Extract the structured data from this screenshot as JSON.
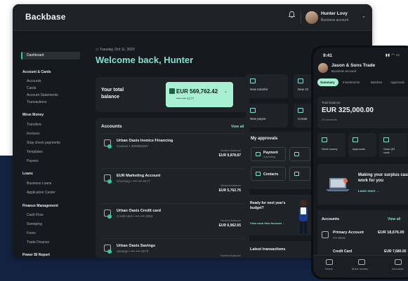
{
  "desktop": {
    "brand": "Backbase",
    "user": {
      "name": "Hunter Lovy",
      "subtitle": "Business account"
    },
    "sidebar": {
      "active": "Dashboard",
      "groups": [
        {
          "title": "Account & Cards",
          "items": [
            "Accounts",
            "Cards",
            "Account Statements",
            "Transactions"
          ]
        },
        {
          "title": "Move Money",
          "items": [
            "Transfers",
            "Invoices",
            "Stop check payments",
            "Templates",
            "Payees"
          ]
        },
        {
          "title": "Loans",
          "items": [
            "Business Loans",
            "Application Center"
          ]
        },
        {
          "title": "Finance Management",
          "items": [
            "Cash Flow",
            "Sweeping",
            "Forex",
            "Trade Finance"
          ]
        },
        {
          "title": "Power BI Report",
          "items": []
        }
      ]
    },
    "date": "Tuesday, Oct 11, 2023",
    "welcome": "Welcome back, Hunter",
    "total_balance": {
      "label": "Your total balance",
      "amount": "EUR 569,762.42",
      "account": "•••• •••• 5177"
    },
    "accounts": {
      "title": "Accounts",
      "view_all": "View all",
      "rows": [
        {
          "name": "Urban Oasis Invoice Financing",
          "sub": "Invoices • 3026084927",
          "balance_label": "Booked balance",
          "balance": "EUR 9,878.87"
        },
        {
          "name": "EUR Marketing Account",
          "sub": "Checking • •••• •••• 5177",
          "balance_label": "Booked balance",
          "balance": "EUR 5,762.76"
        },
        {
          "name": "Urban Oasis Credit card",
          "sub": "Credit card • •••• •••• 2083",
          "balance_label": "Booked balance",
          "balance": "EUR 6,962.65"
        },
        {
          "name": "Urban Oasis Savings",
          "sub": "Savings • •••• •••• 8273",
          "balance_label": "Booked balance",
          "balance": ""
        }
      ]
    },
    "quick_actions": [
      "New transfer",
      "New ch",
      "New payee",
      "Create"
    ],
    "approvals": {
      "title": "My approvals",
      "items": [
        {
          "label": "Payment",
          "sub": "3 pending"
        },
        {
          "label": "Contacts",
          "sub": ""
        }
      ]
    },
    "budget": {
      "title": "Ready for next year's budget?",
      "link": "View cash flow forecast →"
    },
    "latest": "Latest transactions"
  },
  "phone": {
    "time": "9:41",
    "company": "Jason & Sons Trade",
    "subtitle": "Business account",
    "tabs": [
      "Summary",
      "Investments",
      "Batches",
      "Approvals"
    ],
    "active_tab": "Summary",
    "balance": {
      "label": "Total balance",
      "amount": "EUR 325,000.00",
      "sub": "24 accounts"
    },
    "quick_actions": [
      "Send money",
      "Approvals",
      "Scan QR code"
    ],
    "promo": {
      "title": "Making your surplus cash work for you",
      "link": "Learn more →"
    },
    "accounts": {
      "title": "Accounts",
      "view_all": "View all",
      "rows": [
        {
          "name": "Primary Account",
          "sub": "•••• 5823",
          "amount": "EUR 18,676.00"
        },
        {
          "name": "Credit Card",
          "amount": "EUR 7,680.00"
        }
      ]
    },
    "nav": [
      "Home",
      "Move money",
      "Accounts"
    ]
  },
  "colors": {
    "accent": "#7fe3d1",
    "pill": "#a8f0d4",
    "panel": "#1f2327",
    "bg": "#16191d",
    "navy": "#132240"
  }
}
